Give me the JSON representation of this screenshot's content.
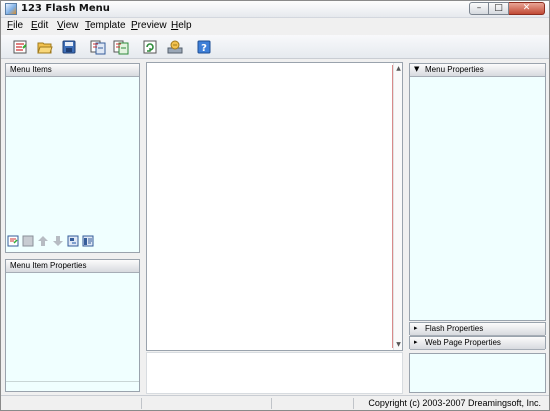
{
  "window": {
    "title": "123 Flash Menu",
    "controls": {
      "minimize": "–",
      "maximize": "□",
      "close": "✕"
    }
  },
  "menubar": {
    "items": [
      "File",
      "Edit",
      "View",
      "Template",
      "Preview",
      "Help"
    ]
  },
  "toolbar": {
    "buttons": [
      "new-icon",
      "open-icon",
      "save-icon",
      "import-icon",
      "export-icon",
      "refresh-icon",
      "publish-icon",
      "help-icon"
    ]
  },
  "left_panel": {
    "menu_items_header": "Menu Items",
    "tools": [
      "add-item-icon",
      "delete-item-icon",
      "move-up-icon",
      "move-down-icon",
      "add-subitem-icon",
      "properties-icon"
    ],
    "menu_item_properties_header": "Menu Item Properties"
  },
  "right_panel": {
    "menu_properties_header": "Menu Properties",
    "flash_properties_header": "Flash Properties",
    "web_page_properties_header": "Web Page Properties"
  },
  "statusbar": {
    "copyright": "Copyright (c) 2003-2007 Dreamingsoft, Inc."
  },
  "colors": {
    "panel_bg": "#f0ffff",
    "window_bg": "#f0f0f0",
    "close_button": "#c14a36"
  }
}
